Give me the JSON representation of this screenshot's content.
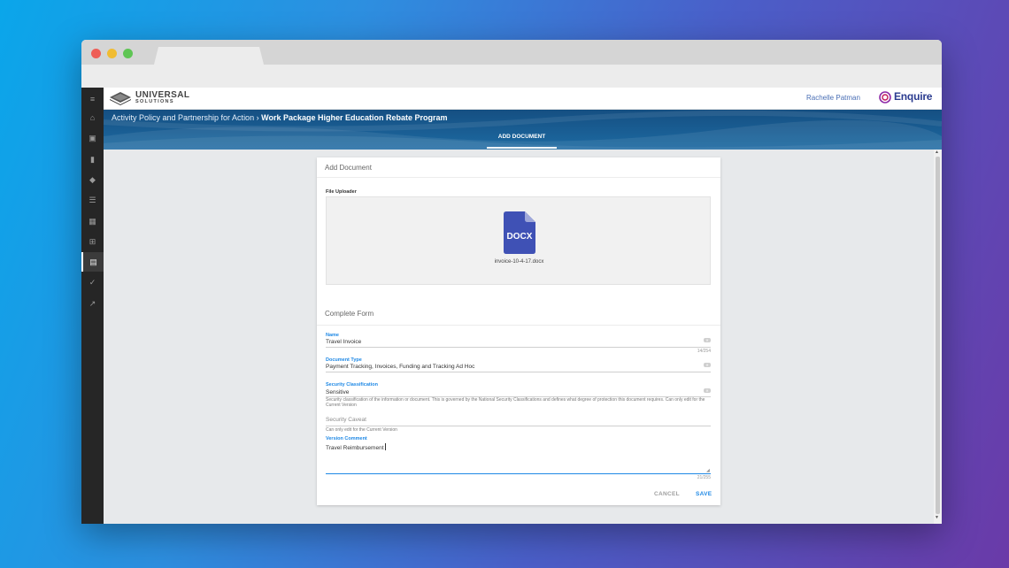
{
  "app": {
    "logo": {
      "line1": "UNIVERSAL",
      "line2": "SOLUTIONS"
    },
    "user_name": "Rachelle Patman",
    "brand": "Enquire",
    "colors": {
      "accent": "#1e88e5",
      "banner": "#1a5c92",
      "sidebar": "#262626",
      "brand": "#2a3b8f"
    }
  },
  "sidebar": {
    "items": [
      {
        "icon": "menu-icon",
        "glyph": "≡"
      },
      {
        "icon": "home-icon",
        "glyph": "⌂"
      },
      {
        "icon": "contact-card-icon",
        "glyph": "▣"
      },
      {
        "icon": "bookmark-icon",
        "glyph": "▮"
      },
      {
        "icon": "layers-icon",
        "glyph": "◆"
      },
      {
        "icon": "list-icon",
        "glyph": "☰"
      },
      {
        "icon": "dashboard-icon",
        "glyph": "▦"
      },
      {
        "icon": "grid-icon",
        "glyph": "⊞"
      },
      {
        "icon": "document-icon",
        "glyph": "▤",
        "active": true
      },
      {
        "icon": "check-trend-icon",
        "glyph": "✓"
      },
      {
        "icon": "trending-icon",
        "glyph": "↗"
      }
    ]
  },
  "breadcrumb": {
    "parent": "Activity Policy and Partnership for Action",
    "separator": "›",
    "current": "Work Package Higher Education Rebate Program"
  },
  "banner_tab": "ADD DOCUMENT",
  "card": {
    "title": "Add Document",
    "uploader": {
      "label": "File Uploader",
      "file_type": "DOCX",
      "file_name": "invoice-10-4-17.docx"
    },
    "form_title": "Complete Form",
    "fields": {
      "name": {
        "label": "Name",
        "value": "Travel Invoice",
        "counter": "14/254"
      },
      "document_type": {
        "label": "Document Type",
        "value": "Payment Tracking, Invoices, Funding and Tracking Ad Hoc"
      },
      "security_classification": {
        "label": "Security Classification",
        "value": "Sensitive",
        "hint": "Security classification of the information or document. This is governed by the National Security Classifications and defines what degree of protection this document requires. Can only edit for the Current Version"
      },
      "security_caveat": {
        "placeholder": "Security Caveat",
        "hint": "Can only edit for the Current Version"
      },
      "version_comment": {
        "label": "Version Comment",
        "value": "Travel Reimbursement",
        "counter": "21/255"
      }
    },
    "actions": {
      "cancel": "CANCEL",
      "save": "SAVE"
    }
  }
}
